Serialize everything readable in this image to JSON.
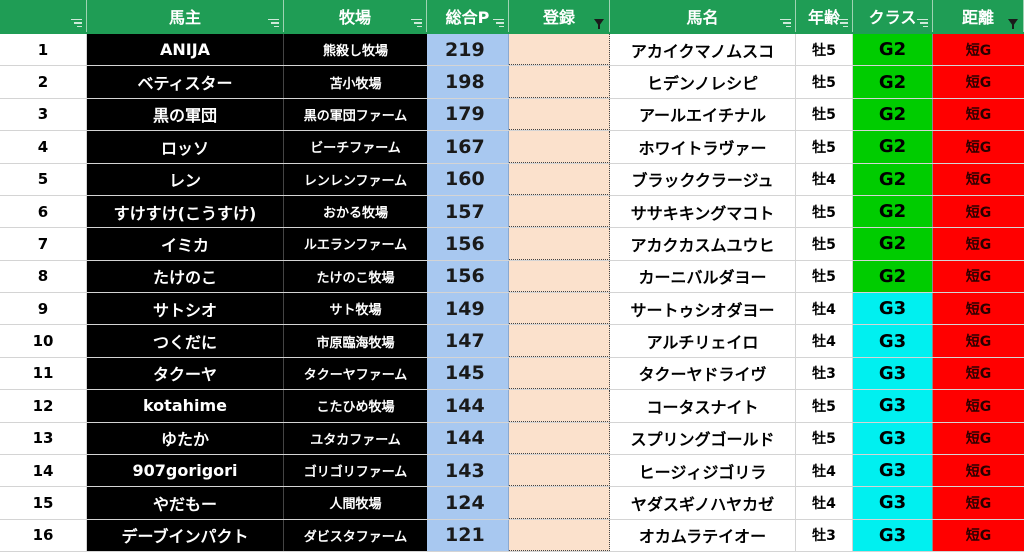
{
  "header": {
    "col0": "",
    "col1": "馬主",
    "col2": "牧場",
    "col3": "総合P",
    "col4": "登録",
    "col5": "馬名",
    "col6": "年齢",
    "col7": "クラス",
    "col8": "距離"
  },
  "colors": {
    "header_bg": "#1f9d55",
    "owner_bg": "#000000",
    "points_bg": "#a8c8f0",
    "register_bg": "#fbe1cc",
    "class_g2": "#00cc00",
    "class_g3": "#00f0f0",
    "distance_bg": "#ff0000"
  },
  "rows": [
    {
      "no": "1",
      "owner": "ANIJA",
      "farm": "熊殺し牧場",
      "points": "219",
      "register": "",
      "horse": "アカイクマノムスコ",
      "age": "牡5",
      "class": "G2",
      "distance": "短G"
    },
    {
      "no": "2",
      "owner": "ベティスター",
      "farm": "苫小牧場",
      "points": "198",
      "register": "",
      "horse": "ヒデンノレシピ",
      "age": "牡5",
      "class": "G2",
      "distance": "短G"
    },
    {
      "no": "3",
      "owner": "黒の軍団",
      "farm": "黒の軍団ファーム",
      "points": "179",
      "register": "",
      "horse": "アールエイチナル",
      "age": "牡5",
      "class": "G2",
      "distance": "短G"
    },
    {
      "no": "4",
      "owner": "ロッソ",
      "farm": "ビーチファーム",
      "points": "167",
      "register": "",
      "horse": "ホワイトラヴァー",
      "age": "牡5",
      "class": "G2",
      "distance": "短G"
    },
    {
      "no": "5",
      "owner": "レン",
      "farm": "レンレンファーム",
      "points": "160",
      "register": "",
      "horse": "ブラッククラージュ",
      "age": "牡4",
      "class": "G2",
      "distance": "短G"
    },
    {
      "no": "6",
      "owner": "すけすけ(こうすけ)",
      "farm": "おかる牧場",
      "points": "157",
      "register": "",
      "horse": "ササキキングマコト",
      "age": "牡5",
      "class": "G2",
      "distance": "短G"
    },
    {
      "no": "7",
      "owner": "イミカ",
      "farm": "ルエランファーム",
      "points": "156",
      "register": "",
      "horse": "アカクカスムユウヒ",
      "age": "牡5",
      "class": "G2",
      "distance": "短G"
    },
    {
      "no": "8",
      "owner": "たけのこ",
      "farm": "たけのこ牧場",
      "points": "156",
      "register": "",
      "horse": "カーニバルダヨー",
      "age": "牡5",
      "class": "G2",
      "distance": "短G"
    },
    {
      "no": "9",
      "owner": "サトシオ",
      "farm": "サト牧場",
      "points": "149",
      "register": "",
      "horse": "サートゥシオダヨー",
      "age": "牡4",
      "class": "G3",
      "distance": "短G"
    },
    {
      "no": "10",
      "owner": "つくだに",
      "farm": "市原臨海牧場",
      "points": "147",
      "register": "",
      "horse": "アルチリェイロ",
      "age": "牡4",
      "class": "G3",
      "distance": "短G"
    },
    {
      "no": "11",
      "owner": "タクーヤ",
      "farm": "タクーヤファーム",
      "points": "145",
      "register": "",
      "horse": "タクーヤドライヴ",
      "age": "牡3",
      "class": "G3",
      "distance": "短G"
    },
    {
      "no": "12",
      "owner": "kotahime",
      "farm": "こたひめ牧場",
      "points": "144",
      "register": "",
      "horse": "コータスナイト",
      "age": "牡5",
      "class": "G3",
      "distance": "短G"
    },
    {
      "no": "13",
      "owner": "ゆたか",
      "farm": "ユタカファーム",
      "points": "144",
      "register": "",
      "horse": "スプリングゴールド",
      "age": "牡5",
      "class": "G3",
      "distance": "短G"
    },
    {
      "no": "14",
      "owner": "907gorigori",
      "farm": "ゴリゴリファーム",
      "points": "143",
      "register": "",
      "horse": "ヒージィジゴリラ",
      "age": "牡4",
      "class": "G3",
      "distance": "短G"
    },
    {
      "no": "15",
      "owner": "やだもー",
      "farm": "人間牧場",
      "points": "124",
      "register": "",
      "horse": "ヤダスギノハヤカゼ",
      "age": "牡4",
      "class": "G3",
      "distance": "短G"
    },
    {
      "no": "16",
      "owner": "デーブインパクト",
      "farm": "ダビスタファーム",
      "points": "121",
      "register": "",
      "horse": "オカムラテイオー",
      "age": "牡3",
      "class": "G3",
      "distance": "短G"
    }
  ]
}
